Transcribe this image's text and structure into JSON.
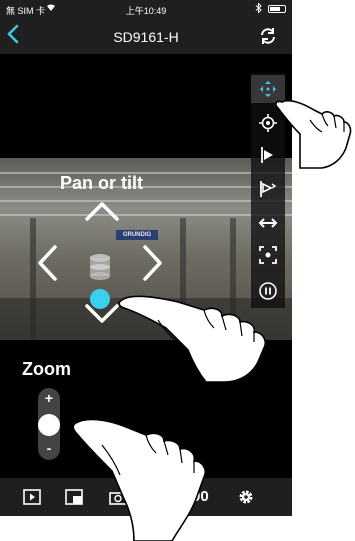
{
  "status_bar": {
    "carrier": "無 SIM 卡",
    "time": "上午10:49"
  },
  "nav": {
    "title": "SD9161-H",
    "back_icon": "chevron-left-icon",
    "refresh_icon": "refresh-icon"
  },
  "overlay": {
    "pan_tilt_label": "Pan or tilt",
    "zoom_label": "Zoom",
    "zoom_plus": "+",
    "zoom_minus": "-"
  },
  "video": {
    "sign_text": "GRUNDIG"
  },
  "side_toolbar": [
    {
      "icon": "move-arrows-icon",
      "active": true
    },
    {
      "icon": "target-icon",
      "active": false
    },
    {
      "icon": "play-flag-icon",
      "active": false
    },
    {
      "icon": "flag-icon",
      "active": false
    },
    {
      "icon": "horizontal-arrows-icon",
      "active": false
    },
    {
      "icon": "focus-frame-icon",
      "active": false
    },
    {
      "icon": "pause-icon",
      "active": false
    }
  ],
  "bottom_bar": {
    "partial_text": "00",
    "icons": [
      "play-icon",
      "layout-icon",
      "gear-icon"
    ]
  },
  "colors": {
    "accent": "#3cc8e8",
    "bar": "#1f1f1f",
    "background": "#000000"
  }
}
